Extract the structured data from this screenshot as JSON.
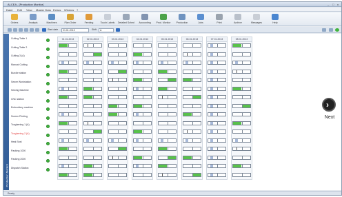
{
  "window": {
    "title": "ALCEA - [Production Monitor]",
    "controls": [
      "_",
      "□",
      "x"
    ]
  },
  "menubar": [
    "Datei",
    "Edit",
    "View",
    "Master Data",
    "Extras",
    "Window",
    "?"
  ],
  "ribbon": [
    {
      "label": "Orders",
      "icon": "orders-icon",
      "color": "#e8b23a"
    },
    {
      "label": "Analysis",
      "icon": "analysis-icon",
      "color": "#7a9cc8"
    },
    {
      "label": "Machines",
      "icon": "machines-icon",
      "color": "#5c8ec4"
    },
    {
      "label": "Plan Order",
      "icon": "plan-order-icon",
      "color": "#d8a436"
    },
    {
      "label": "Feeding",
      "icon": "feeding-icon",
      "color": "#e09a3a"
    },
    {
      "label": "Touch Labels",
      "icon": "touch-labels-icon",
      "color": "#c9cfd8"
    },
    {
      "label": "Detailed Scheduling",
      "icon": "scheduling-icon",
      "color": "#9aa7b8"
    },
    {
      "label": "Accounting",
      "icon": "accounting-icon",
      "color": "#8294b0"
    },
    {
      "label": "Prod. Monitor",
      "icon": "monitor-icon",
      "color": "#4ca34a"
    },
    {
      "label": "Production",
      "icon": "production-icon",
      "color": "#6f93c0"
    },
    {
      "label": "Jobs",
      "icon": "jobs-icon",
      "color": "#5b8fd0"
    },
    {
      "label": "Print",
      "icon": "print-icon",
      "color": "#9aa3ae"
    },
    {
      "label": "Archive",
      "icon": "archive-icon",
      "color": "#b9c0ca"
    },
    {
      "label": "Messages",
      "icon": "messages-icon",
      "color": "#c9ced6"
    },
    {
      "label": "Help",
      "icon": "help-icon",
      "color": "#4a86d0"
    }
  ],
  "toolbar": {
    "date_label": "Start date",
    "date_value": "01.01.2013",
    "shift_label": "Shift",
    "shift_value": "A"
  },
  "side_tab": "Production Monitor",
  "rows": [
    {
      "name": "Cutting Table 1",
      "alert": false
    },
    {
      "name": "Cutting Table 2",
      "alert": false
    },
    {
      "name": "Cutting 3 (A)",
      "alert": false
    },
    {
      "name": "Manual Cutting",
      "alert": false
    },
    {
      "name": "Bundle station",
      "alert": false
    },
    {
      "name": "Sewer Workstation",
      "alert": false
    },
    {
      "name": "Sewing Machine",
      "alert": false
    },
    {
      "name": "CNC station",
      "alert": false
    },
    {
      "name": "Embroidery machine",
      "alert": false
    },
    {
      "name": "Screen Printing",
      "alert": false
    },
    {
      "name": "Toughening 1 (A)",
      "alert": false
    },
    {
      "name": "Toughening 2 (A)",
      "alert": true
    },
    {
      "name": "Heat Seal",
      "alert": false
    },
    {
      "name": "Packing 1000",
      "alert": false
    },
    {
      "name": "Packing 2000",
      "alert": false
    },
    {
      "name": "Dispatch Station",
      "alert": false
    }
  ],
  "dates": [
    "01.01.2013",
    "02.01.2013",
    "03.01.2013",
    "04.01.2013",
    "05.01.2013",
    "06.01.2013",
    "07.01.2013",
    "08.01.2013"
  ],
  "next_button": {
    "label": "Next",
    "symbol": "›"
  },
  "colors": {
    "active": "#58c24a",
    "idle": "#ffffff",
    "partial": "#a7b9d9",
    "dark": "#555555"
  },
  "status": "Ready"
}
